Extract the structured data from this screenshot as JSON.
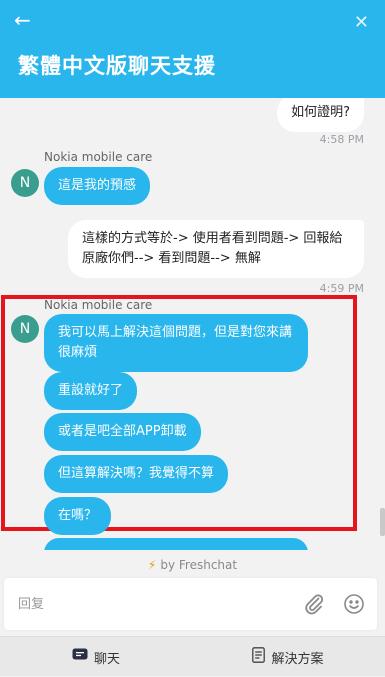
{
  "header": {
    "back_icon": "arrow-left-icon",
    "close_icon": "close-icon",
    "title": "繁體中文版聊天支援"
  },
  "messages": {
    "user_1": "如何證明?",
    "time_1": "4:58 PM",
    "sender_1": "Nokia mobile care",
    "avatar_initial": "N",
    "agent_1": "這是我的預感",
    "user_2": "這樣的方式等於-> 使用者看到問題-> 回報給原廠你們--> 看到問題--> 無解",
    "time_2": "4:59 PM",
    "sender_2": "Nokia mobile care",
    "agent_2": "我可以馬上解決這個問題，但是對您來講很麻煩",
    "agent_3": "重設就好了",
    "agent_4": "或者是吧全部APP卸載",
    "agent_5": "但這算解決嗎？我覺得不算",
    "agent_6": "在嗎？"
  },
  "powered_by": "by Freshchat",
  "composer": {
    "placeholder": "回复",
    "attach_icon": "paperclip-icon",
    "emoji_icon": "smiley-icon"
  },
  "tabs": [
    {
      "label": "聊天",
      "icon": "chat-icon"
    },
    {
      "label": "解決方案",
      "icon": "document-icon"
    }
  ],
  "colors": {
    "accent": "#29b6ec",
    "highlight": "#e5161b",
    "avatar": "#3a9e8f"
  }
}
